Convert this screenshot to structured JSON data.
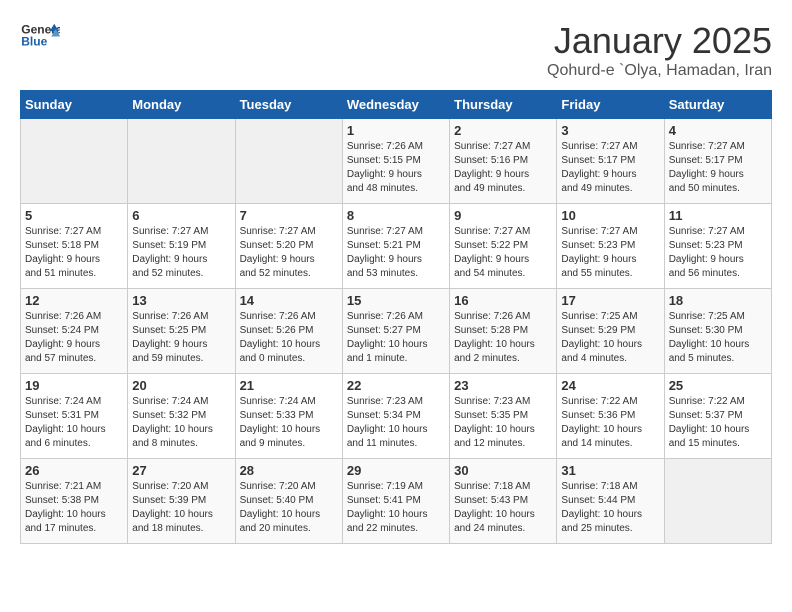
{
  "header": {
    "logo_general": "General",
    "logo_blue": "Blue",
    "month_title": "January 2025",
    "subtitle": "Qohurd-e `Olya, Hamadan, Iran"
  },
  "days_of_week": [
    "Sunday",
    "Monday",
    "Tuesday",
    "Wednesday",
    "Thursday",
    "Friday",
    "Saturday"
  ],
  "weeks": [
    [
      {
        "day": "",
        "content": ""
      },
      {
        "day": "",
        "content": ""
      },
      {
        "day": "",
        "content": ""
      },
      {
        "day": "1",
        "content": "Sunrise: 7:26 AM\nSunset: 5:15 PM\nDaylight: 9 hours\nand 48 minutes."
      },
      {
        "day": "2",
        "content": "Sunrise: 7:27 AM\nSunset: 5:16 PM\nDaylight: 9 hours\nand 49 minutes."
      },
      {
        "day": "3",
        "content": "Sunrise: 7:27 AM\nSunset: 5:17 PM\nDaylight: 9 hours\nand 49 minutes."
      },
      {
        "day": "4",
        "content": "Sunrise: 7:27 AM\nSunset: 5:17 PM\nDaylight: 9 hours\nand 50 minutes."
      }
    ],
    [
      {
        "day": "5",
        "content": "Sunrise: 7:27 AM\nSunset: 5:18 PM\nDaylight: 9 hours\nand 51 minutes."
      },
      {
        "day": "6",
        "content": "Sunrise: 7:27 AM\nSunset: 5:19 PM\nDaylight: 9 hours\nand 52 minutes."
      },
      {
        "day": "7",
        "content": "Sunrise: 7:27 AM\nSunset: 5:20 PM\nDaylight: 9 hours\nand 52 minutes."
      },
      {
        "day": "8",
        "content": "Sunrise: 7:27 AM\nSunset: 5:21 PM\nDaylight: 9 hours\nand 53 minutes."
      },
      {
        "day": "9",
        "content": "Sunrise: 7:27 AM\nSunset: 5:22 PM\nDaylight: 9 hours\nand 54 minutes."
      },
      {
        "day": "10",
        "content": "Sunrise: 7:27 AM\nSunset: 5:23 PM\nDaylight: 9 hours\nand 55 minutes."
      },
      {
        "day": "11",
        "content": "Sunrise: 7:27 AM\nSunset: 5:23 PM\nDaylight: 9 hours\nand 56 minutes."
      }
    ],
    [
      {
        "day": "12",
        "content": "Sunrise: 7:26 AM\nSunset: 5:24 PM\nDaylight: 9 hours\nand 57 minutes."
      },
      {
        "day": "13",
        "content": "Sunrise: 7:26 AM\nSunset: 5:25 PM\nDaylight: 9 hours\nand 59 minutes."
      },
      {
        "day": "14",
        "content": "Sunrise: 7:26 AM\nSunset: 5:26 PM\nDaylight: 10 hours\nand 0 minutes."
      },
      {
        "day": "15",
        "content": "Sunrise: 7:26 AM\nSunset: 5:27 PM\nDaylight: 10 hours\nand 1 minute."
      },
      {
        "day": "16",
        "content": "Sunrise: 7:26 AM\nSunset: 5:28 PM\nDaylight: 10 hours\nand 2 minutes."
      },
      {
        "day": "17",
        "content": "Sunrise: 7:25 AM\nSunset: 5:29 PM\nDaylight: 10 hours\nand 4 minutes."
      },
      {
        "day": "18",
        "content": "Sunrise: 7:25 AM\nSunset: 5:30 PM\nDaylight: 10 hours\nand 5 minutes."
      }
    ],
    [
      {
        "day": "19",
        "content": "Sunrise: 7:24 AM\nSunset: 5:31 PM\nDaylight: 10 hours\nand 6 minutes."
      },
      {
        "day": "20",
        "content": "Sunrise: 7:24 AM\nSunset: 5:32 PM\nDaylight: 10 hours\nand 8 minutes."
      },
      {
        "day": "21",
        "content": "Sunrise: 7:24 AM\nSunset: 5:33 PM\nDaylight: 10 hours\nand 9 minutes."
      },
      {
        "day": "22",
        "content": "Sunrise: 7:23 AM\nSunset: 5:34 PM\nDaylight: 10 hours\nand 11 minutes."
      },
      {
        "day": "23",
        "content": "Sunrise: 7:23 AM\nSunset: 5:35 PM\nDaylight: 10 hours\nand 12 minutes."
      },
      {
        "day": "24",
        "content": "Sunrise: 7:22 AM\nSunset: 5:36 PM\nDaylight: 10 hours\nand 14 minutes."
      },
      {
        "day": "25",
        "content": "Sunrise: 7:22 AM\nSunset: 5:37 PM\nDaylight: 10 hours\nand 15 minutes."
      }
    ],
    [
      {
        "day": "26",
        "content": "Sunrise: 7:21 AM\nSunset: 5:38 PM\nDaylight: 10 hours\nand 17 minutes."
      },
      {
        "day": "27",
        "content": "Sunrise: 7:20 AM\nSunset: 5:39 PM\nDaylight: 10 hours\nand 18 minutes."
      },
      {
        "day": "28",
        "content": "Sunrise: 7:20 AM\nSunset: 5:40 PM\nDaylight: 10 hours\nand 20 minutes."
      },
      {
        "day": "29",
        "content": "Sunrise: 7:19 AM\nSunset: 5:41 PM\nDaylight: 10 hours\nand 22 minutes."
      },
      {
        "day": "30",
        "content": "Sunrise: 7:18 AM\nSunset: 5:43 PM\nDaylight: 10 hours\nand 24 minutes."
      },
      {
        "day": "31",
        "content": "Sunrise: 7:18 AM\nSunset: 5:44 PM\nDaylight: 10 hours\nand 25 minutes."
      },
      {
        "day": "",
        "content": ""
      }
    ]
  ]
}
